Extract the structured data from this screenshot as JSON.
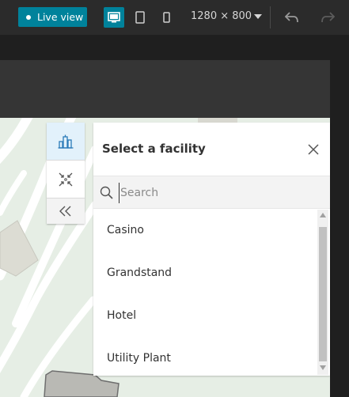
{
  "toolbar": {
    "live_view_label": "Live view",
    "resolution": "1280 × 800",
    "devices": [
      "desktop",
      "tablet",
      "phone"
    ],
    "active_device": "desktop",
    "accent_color": "#00829b"
  },
  "action_bar": {
    "items": [
      {
        "name": "facilities",
        "icon": "buildings-icon",
        "active": true
      },
      {
        "name": "collapse-map",
        "icon": "minimize-icon",
        "active": false
      },
      {
        "name": "collapse-panel",
        "icon": "chevrons-left-icon",
        "active": false
      }
    ]
  },
  "panel": {
    "title": "Select a facility",
    "search_placeholder": "Search",
    "facilities": [
      {
        "label": "Casino"
      },
      {
        "label": "Grandstand"
      },
      {
        "label": "Hotel"
      },
      {
        "label": "Utility Plant"
      }
    ]
  }
}
